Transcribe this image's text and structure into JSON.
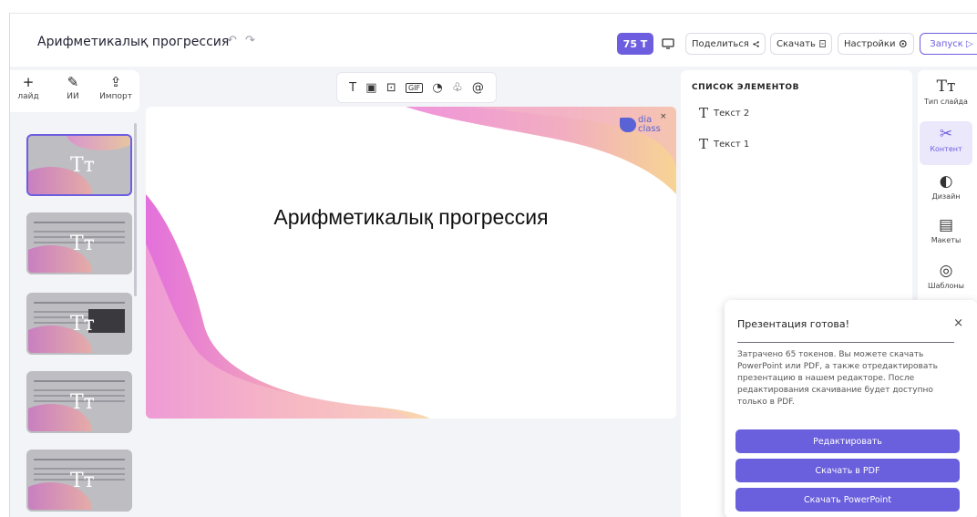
{
  "header": {
    "title": "Арифметикалық прогрессия",
    "undo_icon": "↶",
    "redo_icon": "↷",
    "tokens": "75 Т",
    "share_label": "Поделиться",
    "share_icon": "share-icon",
    "download_label": "Скачать",
    "download_icon": "file-icon",
    "settings_label": "Настройки",
    "settings_icon": "gear-icon",
    "run_label": "Запуск ▷"
  },
  "tools": [
    {
      "icon": "+",
      "label": "лайд"
    },
    {
      "icon": "✎",
      "label": "ИИ"
    },
    {
      "icon": "⇪",
      "label": "Импорт"
    }
  ],
  "insert_bar": [
    "T",
    "▣",
    "⊡",
    "GIF",
    "◔",
    "♧",
    "@"
  ],
  "slide": {
    "title": "Арифметикалық прогрессия",
    "logo_top": "dia",
    "logo_bottom": "class",
    "logo_close": "×"
  },
  "thumbs": {
    "glyph": "Tт"
  },
  "element_list": {
    "heading": "СПИСОК ЭЛЕМЕНТОВ",
    "items": [
      {
        "glyph": "T",
        "label": "Текст 2"
      },
      {
        "glyph": "T",
        "label": "Текст 1"
      }
    ]
  },
  "rail": [
    {
      "icon": "Tт",
      "label": "Тип слайда"
    },
    {
      "icon": "✂",
      "label": "Контент"
    },
    {
      "icon": "◐",
      "label": "Дизайн"
    },
    {
      "icon": "▤",
      "label": "Макеты"
    },
    {
      "icon": "◎",
      "label": "Шаблоны"
    }
  ],
  "popup": {
    "title": "Презентация готова!",
    "close": "×",
    "text": "Затрачено 65 токенов. Вы можете скачать PowerPoint или PDF, а также отредактировать презентацию в нашем редакторе. После редактирования скачивание будет доступно только в PDF.",
    "edit_label": "Редактировать",
    "pdf_label": "Скачать в PDF",
    "ppt_label": "Скачать PowerPoint"
  },
  "colors": {
    "accent": "#6d5ee0",
    "brand_logo": "#5a63d6",
    "panel_bg": "#f3f4f8"
  }
}
